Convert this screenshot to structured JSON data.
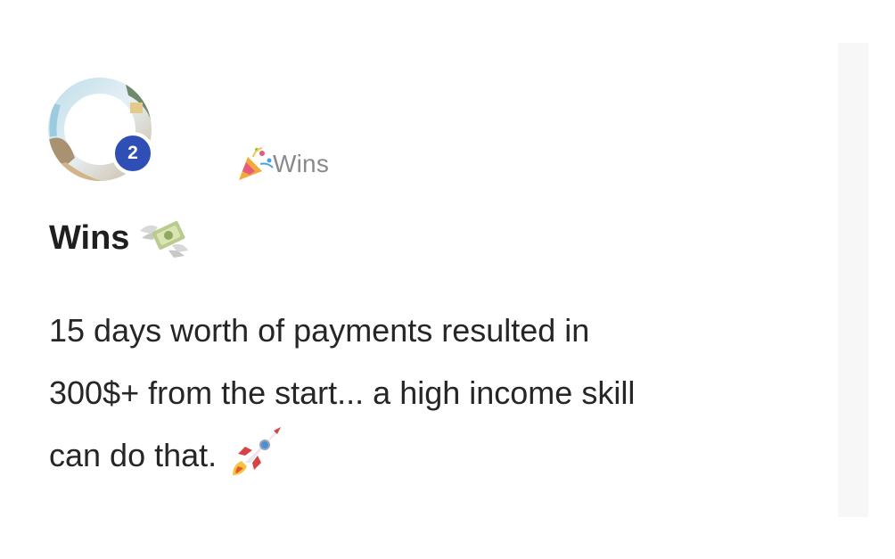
{
  "post": {
    "avatar_icon": "user-avatar-photo",
    "level_badge": "2",
    "category": {
      "icon": "party-popper-icon",
      "label": "Wins"
    },
    "title": "Wins",
    "title_icon": "money-with-wings-icon",
    "body_lines": [
      "15 days worth of payments resulted in",
      "300$+ from the start... a high income skill",
      "can do that."
    ],
    "body_end_icon": "rocket-icon"
  },
  "colors": {
    "badge_bg": "#2f4fb6",
    "category_text": "#8a8a8a",
    "title_text": "#1f1f1f",
    "body_text": "#262626"
  }
}
